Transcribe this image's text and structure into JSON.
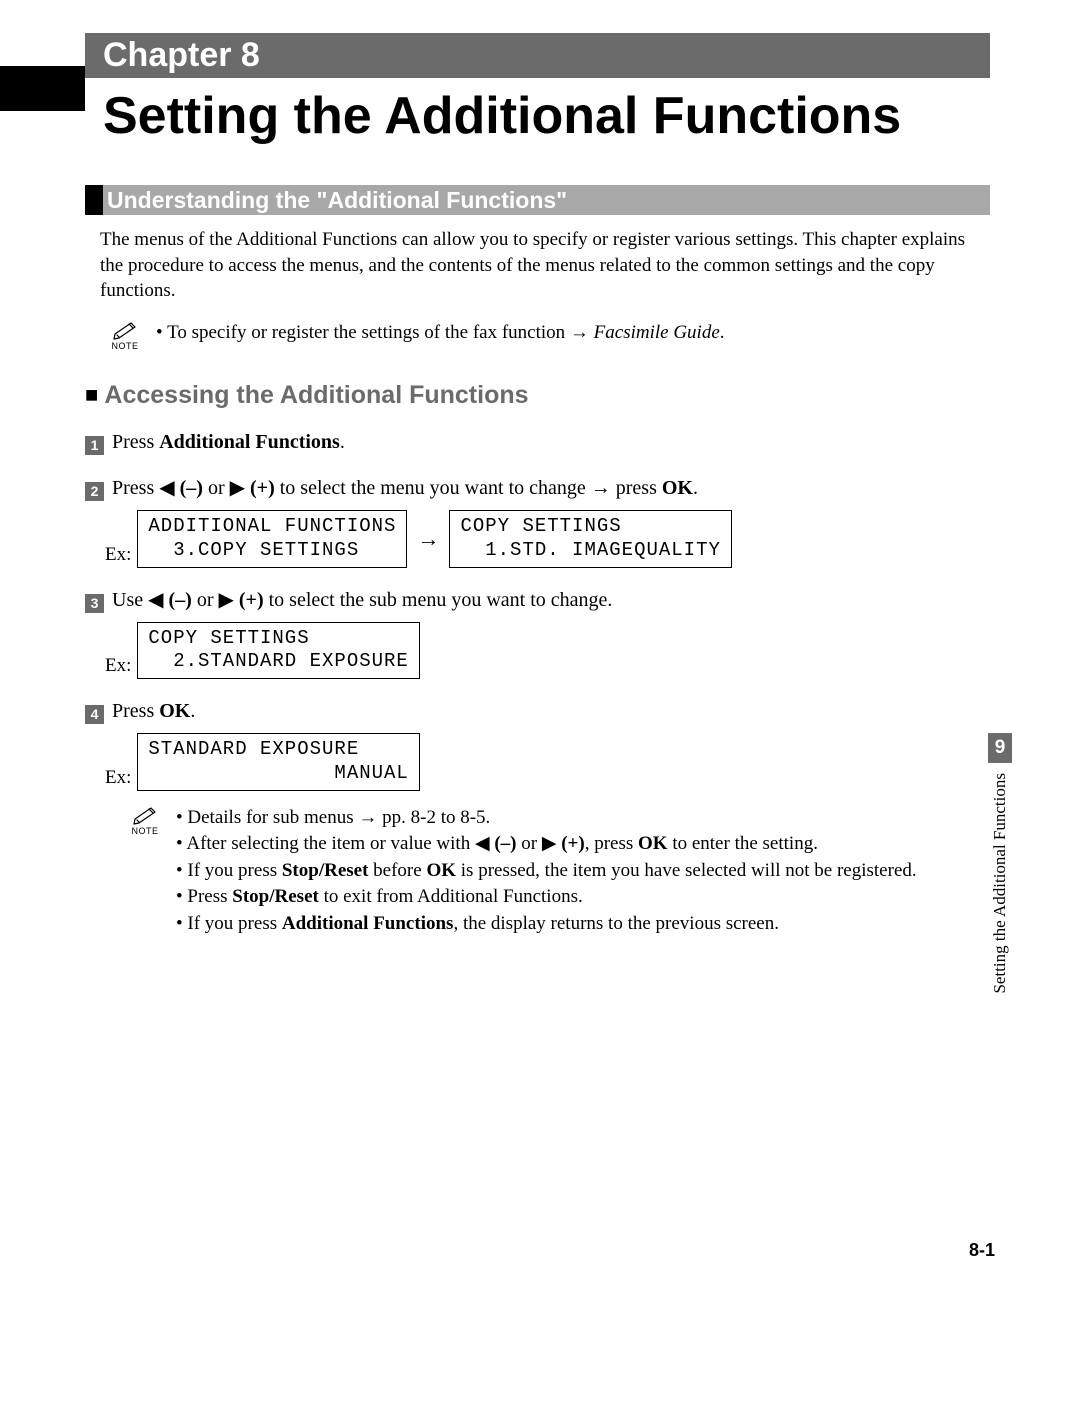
{
  "chapter": {
    "label": "Chapter 8",
    "title": "Setting the Additional Functions"
  },
  "section1": {
    "title": "Understanding the \"Additional Functions\"",
    "intro": "The menus of the Additional Functions can allow you to specify or register various settings. This chapter explains the procedure to access the menus, and the contents of the menus related to the common settings and the copy functions.",
    "note_prefix": "To specify or register the settings of the fax function → ",
    "note_ref": "Facsimile Guide",
    "note_suffix": "."
  },
  "subsection": {
    "title": "Accessing the Additional Functions"
  },
  "steps": {
    "s1": {
      "num": "1",
      "prefix": "Press ",
      "bold": "Additional Functions",
      "suffix": "."
    },
    "s2": {
      "num": "2",
      "text_parts": {
        "a": "Press ",
        "b": " (–)",
        "c": " or ",
        "d": " (+)",
        "e": " to select the menu you want to change → press ",
        "ok": "OK",
        "f": "."
      },
      "ex_label": "Ex:",
      "lcd1_l1": "ADDITIONAL FUNCTIONS",
      "lcd1_l2": "  3.COPY SETTINGS",
      "arrow": "→",
      "lcd2_l1": "COPY SETTINGS",
      "lcd2_l2": "  1.STD. IMAGEQUALITY"
    },
    "s3": {
      "num": "3",
      "text_parts": {
        "a": "Use ",
        "b": " (–)",
        "c": " or ",
        "d": " (+)",
        "e": " to select the sub menu you want to change."
      },
      "ex_label": "Ex:",
      "lcd_l1": "COPY SETTINGS",
      "lcd_l2": "  2.STANDARD EXPOSURE"
    },
    "s4": {
      "num": "4",
      "prefix": "Press ",
      "ok": "OK",
      "suffix": ".",
      "ex_label": "Ex:",
      "lcd_l1": "STANDARD EXPOSURE",
      "lcd_l2": "               MANUAL"
    }
  },
  "step4_notes": {
    "n1": "Details for sub menus → pp. 8-2 to 8-5.",
    "n2_a": "After selecting the item or value with ",
    "n2_b": " (–)",
    "n2_c": " or ",
    "n2_d": " (+)",
    "n2_e": ", press ",
    "n2_ok": "OK",
    "n2_f": " to enter the setting.",
    "n3_a": "If you press ",
    "n3_b": "Stop/Reset",
    "n3_c": " before ",
    "n3_d": "OK",
    "n3_e": " is pressed, the item you have selected will not be registered.",
    "n4_a": "Press ",
    "n4_b": "Stop/Reset",
    "n4_c": " to exit from Additional Functions.",
    "n5_a": "If you press ",
    "n5_b": "Additional Functions",
    "n5_c": ", the display returns to the previous screen."
  },
  "side_tab": {
    "num": "9",
    "text": "Setting the Additional Functions"
  },
  "page_number": "8-1",
  "note_label": "NOTE"
}
